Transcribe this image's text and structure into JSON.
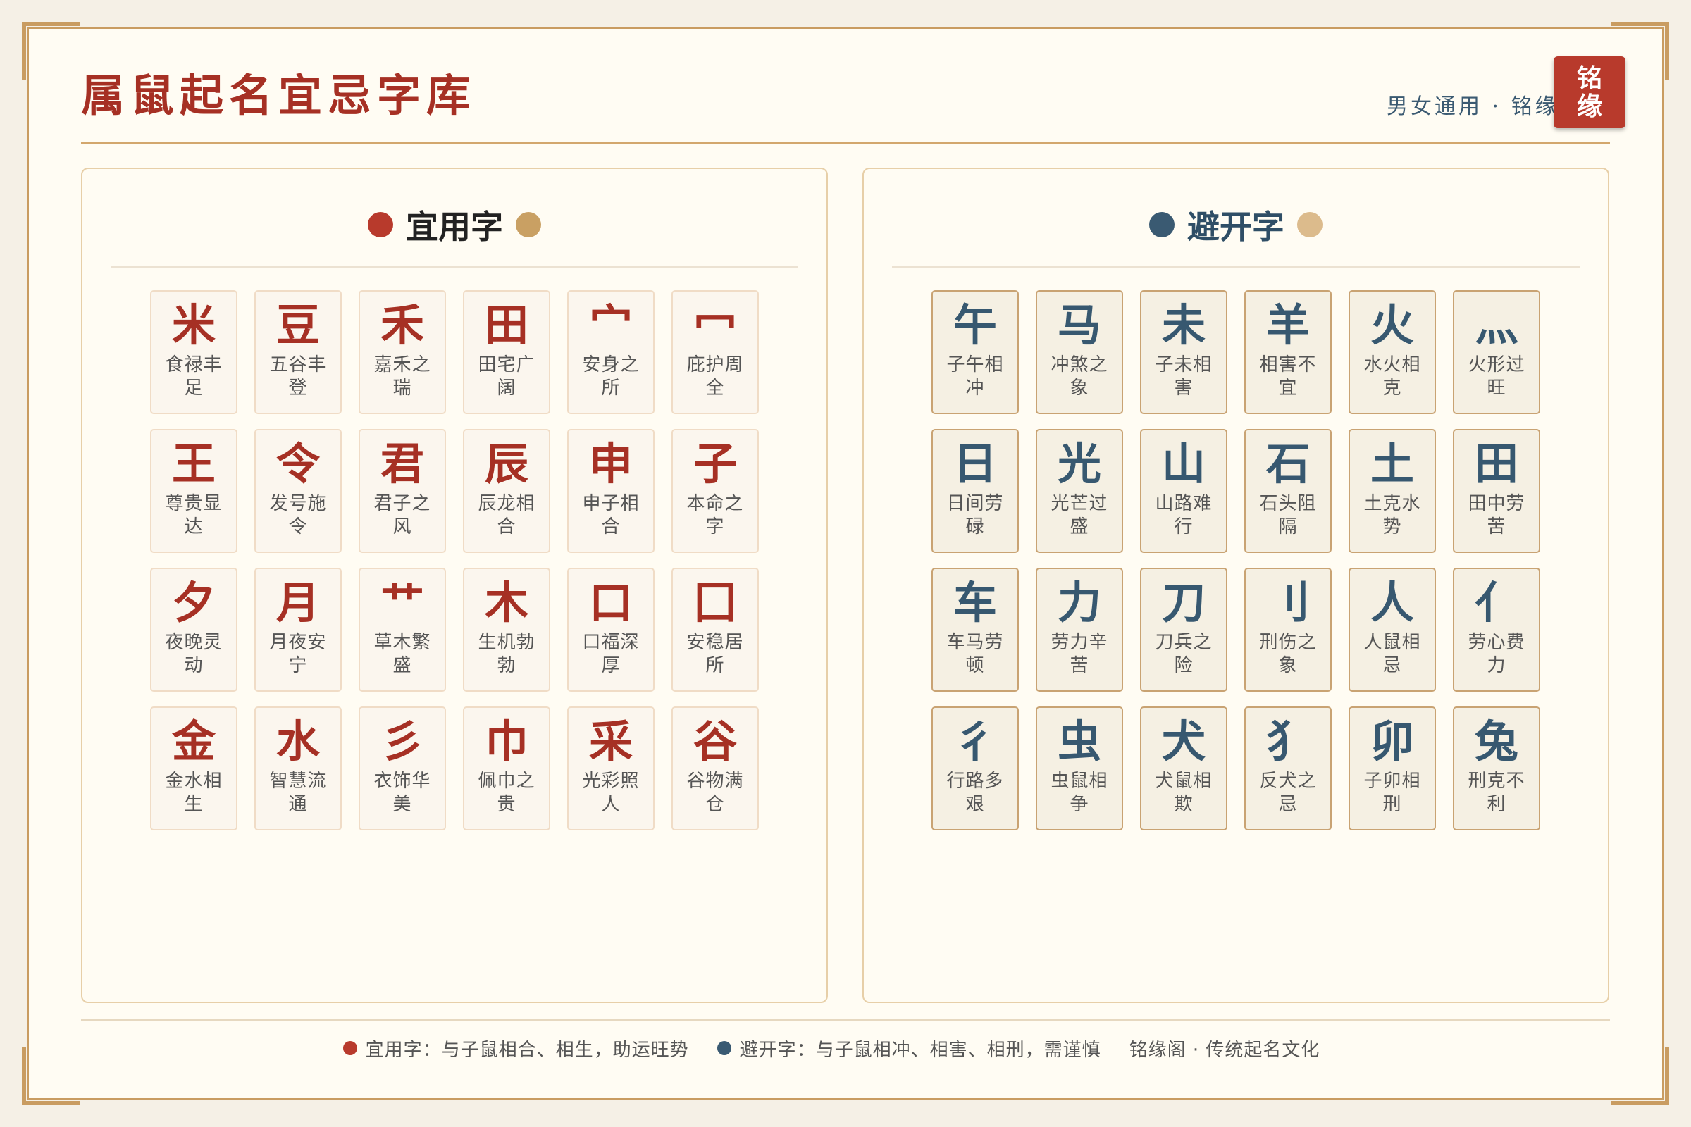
{
  "header": {
    "title": "属鼠起名宜忌字库",
    "subtitle": "男女通用 · 铭缘阁",
    "seal_text": "铭缘"
  },
  "colors": {
    "primary_red": "#a63024",
    "seal_red": "#b83a2c",
    "navy": "#375870",
    "gold": "#c99c61",
    "tan": "#dcbb8c",
    "background": "#fffcf3"
  },
  "good_panel": {
    "title": "宜用字",
    "chars": [
      {
        "char": "米",
        "desc": "食禄丰足"
      },
      {
        "char": "豆",
        "desc": "五谷丰登"
      },
      {
        "char": "禾",
        "desc": "嘉禾之瑞"
      },
      {
        "char": "田",
        "desc": "田宅广阔"
      },
      {
        "char": "宀",
        "desc": "安身之所"
      },
      {
        "char": "冖",
        "desc": "庇护周全"
      },
      {
        "char": "王",
        "desc": "尊贵显达"
      },
      {
        "char": "令",
        "desc": "发号施令"
      },
      {
        "char": "君",
        "desc": "君子之风"
      },
      {
        "char": "辰",
        "desc": "辰龙相合"
      },
      {
        "char": "申",
        "desc": "申子相合"
      },
      {
        "char": "子",
        "desc": "本命之字"
      },
      {
        "char": "夕",
        "desc": "夜晚灵动"
      },
      {
        "char": "月",
        "desc": "月夜安宁"
      },
      {
        "char": "艹",
        "desc": "草木繁盛"
      },
      {
        "char": "木",
        "desc": "生机勃勃"
      },
      {
        "char": "口",
        "desc": "口福深厚"
      },
      {
        "char": "囗",
        "desc": "安稳居所"
      },
      {
        "char": "金",
        "desc": "金水相生"
      },
      {
        "char": "水",
        "desc": "智慧流通"
      },
      {
        "char": "彡",
        "desc": "衣饰华美"
      },
      {
        "char": "巾",
        "desc": "佩巾之贵"
      },
      {
        "char": "采",
        "desc": "光彩照人"
      },
      {
        "char": "谷",
        "desc": "谷物满仓"
      }
    ]
  },
  "bad_panel": {
    "title": "避开字",
    "chars": [
      {
        "char": "午",
        "desc": "子午相冲"
      },
      {
        "char": "马",
        "desc": "冲煞之象"
      },
      {
        "char": "未",
        "desc": "子未相害"
      },
      {
        "char": "羊",
        "desc": "相害不宜"
      },
      {
        "char": "火",
        "desc": "水火相克"
      },
      {
        "char": "灬",
        "desc": "火形过旺"
      },
      {
        "char": "日",
        "desc": "日间劳碌"
      },
      {
        "char": "光",
        "desc": "光芒过盛"
      },
      {
        "char": "山",
        "desc": "山路难行"
      },
      {
        "char": "石",
        "desc": "石头阻隔"
      },
      {
        "char": "土",
        "desc": "土克水势"
      },
      {
        "char": "田",
        "desc": "田中劳苦"
      },
      {
        "char": "车",
        "desc": "车马劳顿"
      },
      {
        "char": "力",
        "desc": "劳力辛苦"
      },
      {
        "char": "刀",
        "desc": "刀兵之险"
      },
      {
        "char": "刂",
        "desc": "刑伤之象"
      },
      {
        "char": "人",
        "desc": "人鼠相忌"
      },
      {
        "char": "亻",
        "desc": "劳心费力"
      },
      {
        "char": "彳",
        "desc": "行路多艰"
      },
      {
        "char": "虫",
        "desc": "虫鼠相争"
      },
      {
        "char": "犬",
        "desc": "犬鼠相欺"
      },
      {
        "char": "犭",
        "desc": "反犬之忌"
      },
      {
        "char": "卯",
        "desc": "子卯相刑"
      },
      {
        "char": "兔",
        "desc": "刑克不利"
      }
    ]
  },
  "footer": {
    "good_note": "宜用字：与子鼠相合、相生，助运旺势",
    "bad_note": "避开字：与子鼠相冲、相害、相刑，需谨慎",
    "brand": "铭缘阁 · 传统起名文化"
  }
}
